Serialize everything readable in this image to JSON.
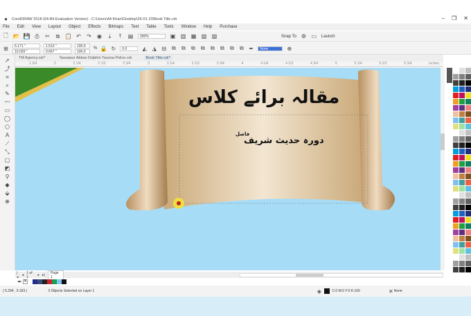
{
  "window": {
    "title": "CorelDRAW 2018 (64-Bit Evaluation Version) - C:\\Users\\Ali Khan\\Desktop\\26-01-23\\Book Title.cdr"
  },
  "menu": [
    "File",
    "Edit",
    "View",
    "Layout",
    "Object",
    "Effects",
    "Bitmaps",
    "Text",
    "Table",
    "Tools",
    "Window",
    "Help",
    "Purchase"
  ],
  "toolbar": {
    "zoom": "300%",
    "snap": "Snap To",
    "launch": "Launch"
  },
  "propbar": {
    "x": "6.171 \"",
    "y": "10.029 \"",
    "w": "1.513 \"",
    "h": "0.667 \"",
    "sx": "100.0",
    "sy": "100.0",
    "pct": "%",
    "rotation": "0.0",
    "outline": "None"
  },
  "tabs": [
    "TM Agency.cdr*",
    "Tassawur Abbas Dolphin Taunsa Police.cdr",
    "Book Title.cdr*"
  ],
  "ruler": [
    "1 3/4",
    "2",
    "2 1/4",
    "2 1/2",
    "2 3/4",
    "3",
    "3 1/4",
    "3 1/2",
    "3 3/4",
    "4",
    "4 1/4",
    "4 1/2",
    "4 3/4",
    "5",
    "5 1/4",
    "5 1/2",
    "5 3/4",
    "inches"
  ],
  "artwork": {
    "heading": "مقالہ برائے کلاس",
    "subheading": "دورہ حدیث شریف",
    "tag": "فاضل"
  },
  "pagenav": {
    "count": "1 of 1",
    "page": "Page 1"
  },
  "colors": {
    "canvas": "#a6dcf6",
    "swatches": [
      "#ffffff",
      "#1f2f8a",
      "#3a4a7a",
      "#222222",
      "#d02030",
      "#18a050",
      "#7ec8f0",
      "#111111"
    ]
  },
  "status": {
    "coords": "( 5.294 , 9.183 )",
    "message": "3 Objects Selected on Layer 1",
    "fill": "C:0 M:0 Y:0 K:100",
    "outline": "None"
  }
}
